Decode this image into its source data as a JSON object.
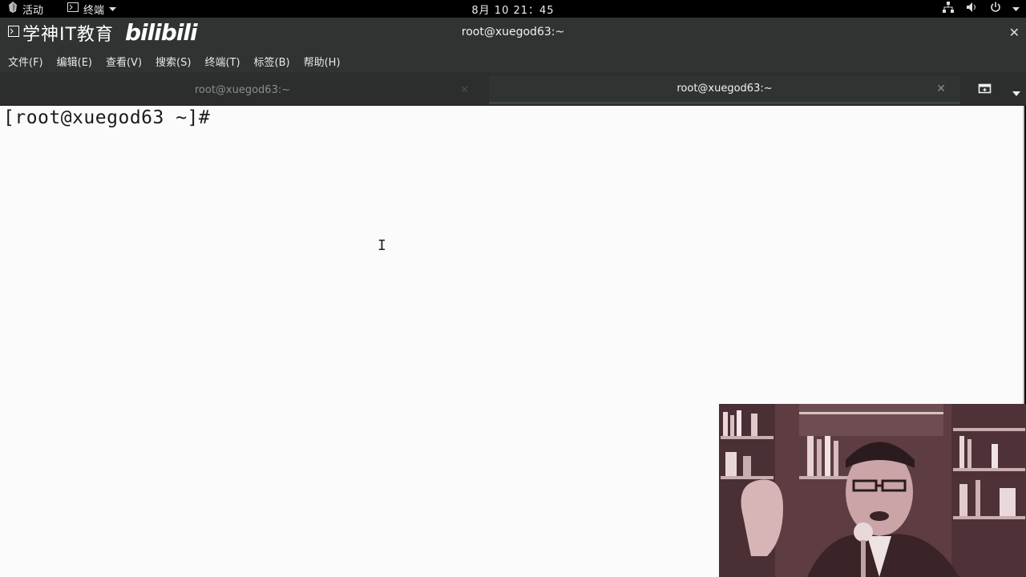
{
  "topbar": {
    "activities_label": "活动",
    "app_label": "终端",
    "clock": "8月 10  21：45"
  },
  "window": {
    "logo_text": "学神IT教育",
    "logo_bili": "bilibili",
    "title": "root@xuegod63:~"
  },
  "menu": {
    "file": "文件(F)",
    "edit": "编辑(E)",
    "view": "查看(V)",
    "search": "搜索(S)",
    "terminal": "终端(T)",
    "tabs": "标签(B)",
    "help": "帮助(H)"
  },
  "tabs": [
    {
      "label": "root@xuegod63:~",
      "active": false
    },
    {
      "label": "root@xuegod63:~",
      "active": true
    }
  ],
  "terminal": {
    "prompt": "[root@xuegod63 ~]#"
  },
  "colors": {
    "topbar_bg": "#000000",
    "titlebar_bg": "#2f3332",
    "terminal_bg": "#fbfbfb",
    "terminal_fg": "#1a1a1a"
  },
  "icons": {
    "activities": "app-icon",
    "app": "terminal-icon",
    "network": "network-icon",
    "volume": "volume-icon",
    "power": "power-icon",
    "new_tab": "new-tab-icon",
    "menu": "chevron-down-icon"
  }
}
